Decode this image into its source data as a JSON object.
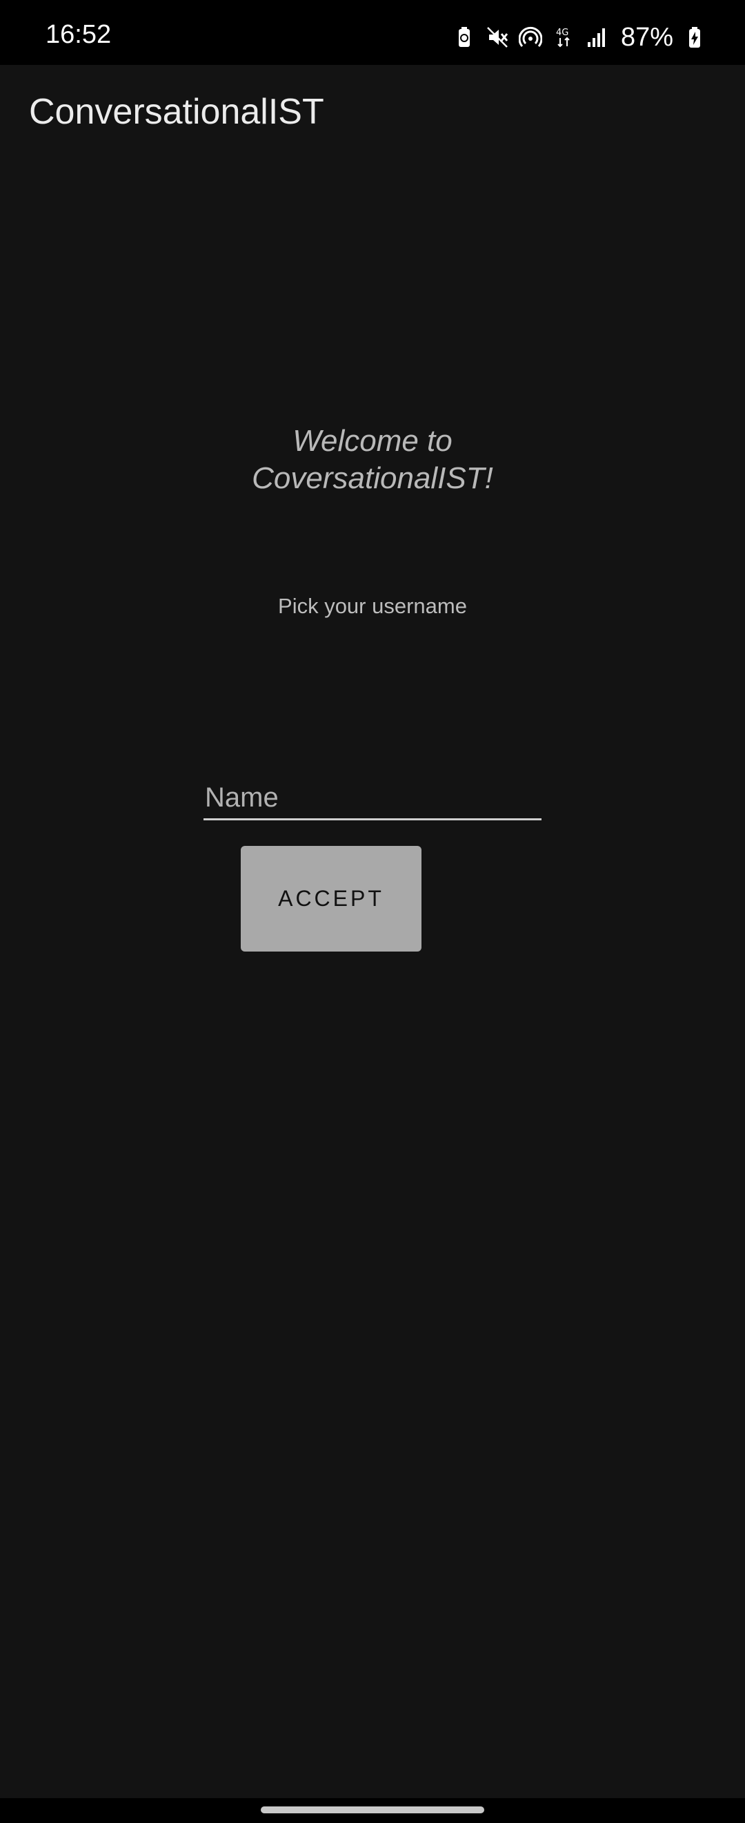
{
  "status_bar": {
    "time": "16:52",
    "battery_percent": "87%",
    "icons": [
      "battery-saver-icon",
      "mute-icon",
      "hotspot-icon",
      "4g-icon",
      "signal-icon",
      "battery-charging-icon"
    ]
  },
  "app": {
    "title": "ConversationalIST"
  },
  "welcome": {
    "line1": "Welcome to",
    "line2": "CoversationalIST!"
  },
  "subtitle": "Pick your username",
  "name_field": {
    "value": "",
    "placeholder": "Name"
  },
  "accept_button": {
    "label": "ACCEPT"
  },
  "colors": {
    "background": "#131313",
    "status_bar": "#000000",
    "button": "#a9a9a9",
    "welcome_text": "#b9b9b9"
  }
}
